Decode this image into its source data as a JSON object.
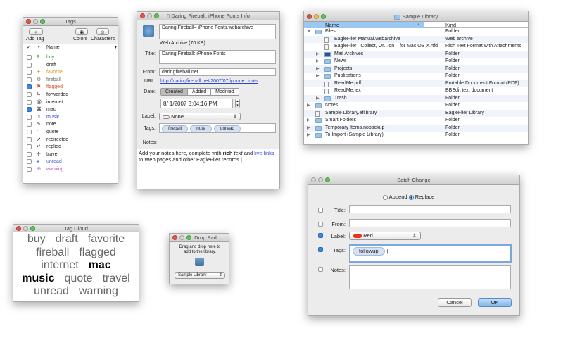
{
  "tags_window": {
    "title": "Tags",
    "add_tag": "Add Tag",
    "colors": "Colors",
    "characters": "Characters",
    "col_check": "✓",
    "col_dot": "•",
    "col_name": "Name",
    "items": [
      {
        "name": "buy",
        "icon": "$",
        "color": "#3a9a3a",
        "checked": false
      },
      {
        "name": "draft",
        "icon": "",
        "color": "#222222",
        "checked": false
      },
      {
        "name": "favorite",
        "icon": "✦",
        "color": "#e8932a",
        "checked": false
      },
      {
        "name": "fireball",
        "icon": "⚙",
        "color": "#777777",
        "checked": false
      },
      {
        "name": "flagged",
        "icon": "⚑",
        "color": "#d2562a",
        "checked": true
      },
      {
        "name": "forwarded",
        "icon": "↳",
        "color": "#222222",
        "checked": false
      },
      {
        "name": "internet",
        "icon": "@",
        "color": "#222222",
        "checked": false
      },
      {
        "name": "mac",
        "icon": "⌘",
        "color": "#222222",
        "checked": true
      },
      {
        "name": "music",
        "icon": "♫",
        "color": "#2f3fc8",
        "checked": false
      },
      {
        "name": "note",
        "icon": "✎",
        "color": "#222222",
        "checked": false
      },
      {
        "name": "quote",
        "icon": "”",
        "color": "#222222",
        "checked": false
      },
      {
        "name": "redirected",
        "icon": "↗",
        "color": "#222222",
        "checked": false
      },
      {
        "name": "replied",
        "icon": "↵",
        "color": "#222222",
        "checked": false
      },
      {
        "name": "travel",
        "icon": "✈",
        "color": "#222222",
        "checked": false
      },
      {
        "name": "unread",
        "icon": "●",
        "color": "#4a63d6",
        "checked": false
      },
      {
        "name": "warning",
        "icon": "☢",
        "color": "#b44fc8",
        "checked": false
      }
    ]
  },
  "info_window": {
    "title": "Daring Fireball: iPhone Fonts Info",
    "filename": "Daring Fireball– iPhone Fonts.webarchive",
    "kind": "Web Archive (70 KB)",
    "title_label": "Title:",
    "title_value": "Daring Fireball: iPhone Fonts",
    "from_label": "From:",
    "from_value": "daringfireball.net",
    "url_label": "URL:",
    "url_value": "http://daringfireball.net/2007/07/iphone_fonts",
    "date_label": "Date:",
    "date_tabs": [
      "Created",
      "Added",
      "Modified"
    ],
    "date_value": "8/ 1/2007   3:04:16 PM",
    "label_label": "Label:",
    "label_value": "None",
    "tags_label": "Tags:",
    "tags": [
      "fireball",
      "note",
      "unread"
    ],
    "notes_label": "Notes:",
    "notes": {
      "a": "Add your notes here, complete with ",
      "b": "rich",
      "c": " ",
      "d": "text",
      "e": " and ",
      "f": "live links",
      "g": " to Web pages and other EagleFiler records."
    }
  },
  "library_window": {
    "title": "Sample Library",
    "col_name": "Name",
    "col_kind": "Kind",
    "rows": [
      {
        "name": "Files",
        "kind": "Folder",
        "level": 0,
        "type": "folder",
        "disclosure": "open"
      },
      {
        "name": "EagleFiler Manual.webarchive",
        "kind": "Web archive",
        "level": 1,
        "type": "doc",
        "disclosure": ""
      },
      {
        "name": "EagleFiler– Collect, Or…on – for Mac OS X.rtfd",
        "kind": "Rich Text Format with Attachments",
        "level": 1,
        "type": "doc",
        "disclosure": ""
      },
      {
        "name": "Mail Archives",
        "kind": "Folder",
        "level": 1,
        "type": "mail",
        "disclosure": "closed"
      },
      {
        "name": "News",
        "kind": "Folder",
        "level": 1,
        "type": "folder",
        "disclosure": "closed"
      },
      {
        "name": "Projects",
        "kind": "Folder",
        "level": 1,
        "type": "folder",
        "disclosure": "closed"
      },
      {
        "name": "Publications",
        "kind": "Folder",
        "level": 1,
        "type": "folder",
        "disclosure": "closed"
      },
      {
        "name": "ReadMe.pdf",
        "kind": "Portable Document Format (PDF)",
        "level": 1,
        "type": "doc",
        "disclosure": ""
      },
      {
        "name": "ReadMe.tex",
        "kind": "BBEdit text document",
        "level": 1,
        "type": "doc",
        "disclosure": ""
      },
      {
        "name": "Trash",
        "kind": "Folder",
        "level": 1,
        "type": "folder",
        "disclosure": "closed"
      },
      {
        "name": "Notes",
        "kind": "Folder",
        "level": 0,
        "type": "folder",
        "disclosure": "closed"
      },
      {
        "name": "Sample Library.eflibrary",
        "kind": "EagleFiler Library",
        "level": 0,
        "type": "doc",
        "disclosure": ""
      },
      {
        "name": "Smart Folders",
        "kind": "Folder",
        "level": 0,
        "type": "folder",
        "disclosure": "closed"
      },
      {
        "name": "Temporary Items.nobackup",
        "kind": "Folder",
        "level": 0,
        "type": "folder",
        "disclosure": "closed"
      },
      {
        "name": "To Import (Sample Library)",
        "kind": "Folder",
        "level": 0,
        "type": "folder",
        "disclosure": "closed"
      }
    ]
  },
  "batch_window": {
    "title": "Batch Change",
    "append": "Append",
    "replace": "Replace",
    "mode": "Replace",
    "title_label": "Title:",
    "from_label": "From:",
    "label_label": "Label:",
    "label_value": "Red",
    "label_color": "#e8321e",
    "tags_label": "Tags:",
    "tag": "followup",
    "notes_label": "Notes:",
    "cancel": "Cancel",
    "ok": "OK",
    "checks": {
      "title": false,
      "from": false,
      "label": true,
      "tags": true,
      "notes": false
    }
  },
  "tag_cloud": {
    "title": "Tag Cloud",
    "lines": [
      [
        {
          "t": "buy",
          "b": false
        },
        {
          "t": "draft",
          "b": false
        },
        {
          "t": "favorite",
          "b": false
        }
      ],
      [
        {
          "t": "fireball",
          "b": false
        },
        {
          "t": "flagged",
          "b": false
        }
      ],
      [
        {
          "t": "internet",
          "b": false
        },
        {
          "t": "mac",
          "b": true
        }
      ],
      [
        {
          "t": "music",
          "b": true
        },
        {
          "t": "quote",
          "b": false
        },
        {
          "t": "travel",
          "b": false
        }
      ],
      [
        {
          "t": "unread",
          "b": false
        },
        {
          "t": "warning",
          "b": false
        }
      ]
    ]
  },
  "drop_pad": {
    "title": "Drop Pad",
    "text": "Drag and drop here to add to the library.",
    "library": "Sample Library"
  }
}
